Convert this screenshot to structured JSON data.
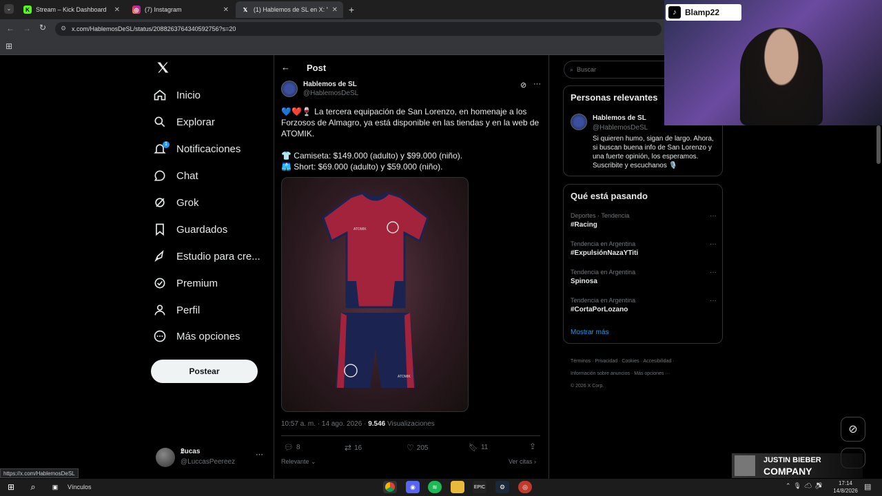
{
  "browser": {
    "tabs": [
      {
        "title": "Stream – Kick Dashboard",
        "favicon": "K"
      },
      {
        "title": "(7) Instagram",
        "favicon": "ig"
      },
      {
        "title": "(1) Hablemos de SL en X: \"",
        "favicon": "X"
      }
    ],
    "url": "x.com/HablemosDeSL/status/2088263764340592756?s=20",
    "status_url": "https://x.com/HablemosDeSL"
  },
  "nav": {
    "items": [
      {
        "label": "Inicio"
      },
      {
        "label": "Explorar"
      },
      {
        "label": "Notificaciones",
        "badge": "1"
      },
      {
        "label": "Chat"
      },
      {
        "label": "Grok"
      },
      {
        "label": "Guardados"
      },
      {
        "label": "Estudio para cre..."
      },
      {
        "label": "Premium"
      },
      {
        "label": "Perfil"
      },
      {
        "label": "Más opciones"
      }
    ],
    "post_button": "Postear",
    "account_name": "𝕷ucas",
    "account_handle": "@LuccasPeereez"
  },
  "post": {
    "header": "Post",
    "author_name": "Hablemos de SL",
    "author_handle": "@HablemosDeSL",
    "text_line1": "💙❤️🍷 La tercera equipación de San Lorenzo, en homenaje a los Forzosos de Almagro, ya está disponible en las tiendas y en la web de ATOMIK.",
    "text_line2": "👕 Camiseta: $149.000 (adulto) y $99.000 (niño).",
    "text_line3": "🩳 Short: $69.000 (adulto) y $59.000 (niño).",
    "timestamp": "10:57 a. m. · 14 ago. 2026 · ",
    "views": "9.546",
    "views_label": " Visualizaciones",
    "replies": "8",
    "reposts": "16",
    "likes": "205",
    "bookmarks": "11",
    "sort_label": "Relevante",
    "quotes_label": "Ver citas"
  },
  "sidebar": {
    "search_placeholder": "Buscar",
    "relevant_title": "Personas relevantes",
    "relevant_name": "Hablemos de SL",
    "relevant_handle": "@HablemosDeSL",
    "relevant_bio": "Si quieren humo, sigan de largo. Ahora, si buscan buena info de San Lorenzo y una fuerte opinión, los esperamos. Suscribite y escuchanos 🎙️",
    "trending_title": "Qué está pasando",
    "trends": [
      {
        "meta": "Deportes · Tendencia",
        "name": "#Racing"
      },
      {
        "meta": "Tendencia en Argentina",
        "name": "#ExpulsiónNazaYTiti"
      },
      {
        "meta": "Tendencia en Argentina",
        "name": "Spinosa"
      },
      {
        "meta": "Tendencia en Argentina",
        "name": "#CortaPorLozano"
      }
    ],
    "show_more": "Mostrar más",
    "footer": [
      "Términos",
      "Privacidad",
      "Cookies",
      "Accesibilidad",
      "Información sobre anuncios",
      "Más opciones ···",
      "© 2026 X Corp."
    ]
  },
  "overlay": {
    "streamer": "Blamp22",
    "music_artist": "JUSTIN BIEBER",
    "music_title": "COMPANY"
  },
  "taskbar": {
    "links_label": "Vínculos",
    "time": "17:14",
    "date": "14/8/2026"
  },
  "colors": {
    "accent": "#1d9bf0",
    "background": "#000000",
    "border": "#2f3336"
  }
}
